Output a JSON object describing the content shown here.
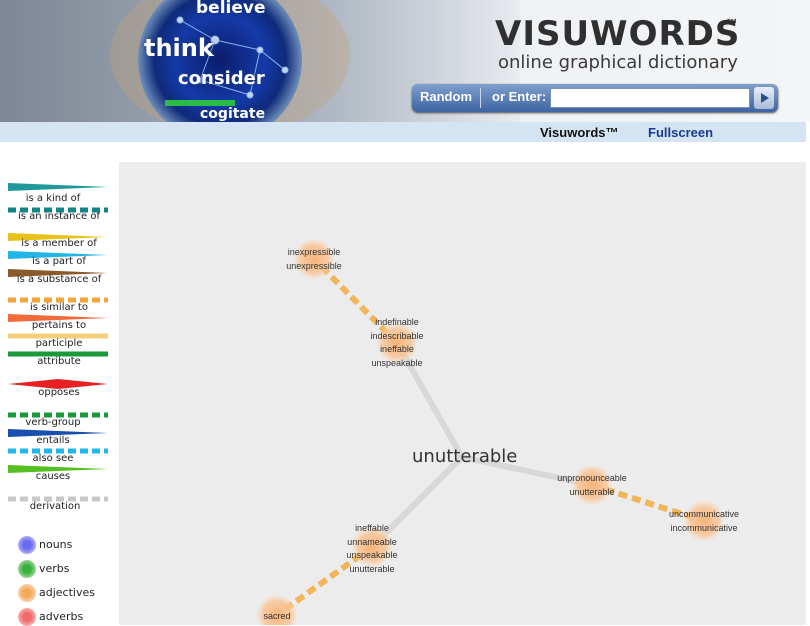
{
  "header": {
    "art_words": [
      "believe",
      "think",
      "consider",
      "cogitate"
    ],
    "logo": "VISUWORDS",
    "logo_tm": "™",
    "tagline": "online graphical dictionary",
    "search": {
      "random_label": "Random",
      "enter_label": "or Enter:",
      "value": "",
      "placeholder": ""
    }
  },
  "nav": {
    "visuwords": "Visuwords™",
    "fullscreen": "Fullscreen"
  },
  "legend": {
    "relations": [
      {
        "label": "is a kind of",
        "color": "#1f9a9a"
      },
      {
        "label": "is an instance of",
        "color": "#118585"
      },
      {
        "label": "is a member of",
        "color": "#e8c21a"
      },
      {
        "label": "is a part of",
        "color": "#22b5e8"
      },
      {
        "label": "is a substance of",
        "color": "#8a5a2a"
      },
      {
        "label": "is similar to",
        "color": "#f3a53b"
      },
      {
        "label": "pertains to",
        "color": "#f06a3a"
      },
      {
        "label": "participle",
        "color": "#f5cf7a"
      },
      {
        "label": "attribute",
        "color": "#1a9a3a"
      },
      {
        "label": "opposes",
        "color": "#e82020"
      },
      {
        "label": "verb-group",
        "color": "#1a9a3a"
      },
      {
        "label": "entails",
        "color": "#1a4fb0"
      },
      {
        "label": "also see",
        "color": "#22b5e8"
      },
      {
        "label": "causes",
        "color": "#55c020"
      },
      {
        "label": "derivation",
        "color": "#c8c8c8"
      }
    ],
    "parts_of_speech": [
      {
        "label": "nouns",
        "color": "#6a6af0"
      },
      {
        "label": "verbs",
        "color": "#3ab03a"
      },
      {
        "label": "adjectives",
        "color": "#f5a85a"
      },
      {
        "label": "adverbs",
        "color": "#f06a6a"
      }
    ]
  },
  "graph": {
    "center": "unutterable",
    "nodes": [
      {
        "id": "n1",
        "words": [
          "inexpressible",
          "unexpressible"
        ]
      },
      {
        "id": "n2",
        "words": [
          "indefinable",
          "indescribable",
          "ineffable",
          "unspeakable"
        ]
      },
      {
        "id": "n3",
        "words": [
          "unpronounceable",
          "unutterable"
        ]
      },
      {
        "id": "n4",
        "words": [
          "uncommunicative",
          "incommunicative"
        ]
      },
      {
        "id": "n5",
        "words": [
          "ineffable",
          "unnameable",
          "unspeakable",
          "unutterable"
        ]
      },
      {
        "id": "n6",
        "words": [
          "sacred"
        ]
      }
    ],
    "node_color": "#f7b47a"
  }
}
